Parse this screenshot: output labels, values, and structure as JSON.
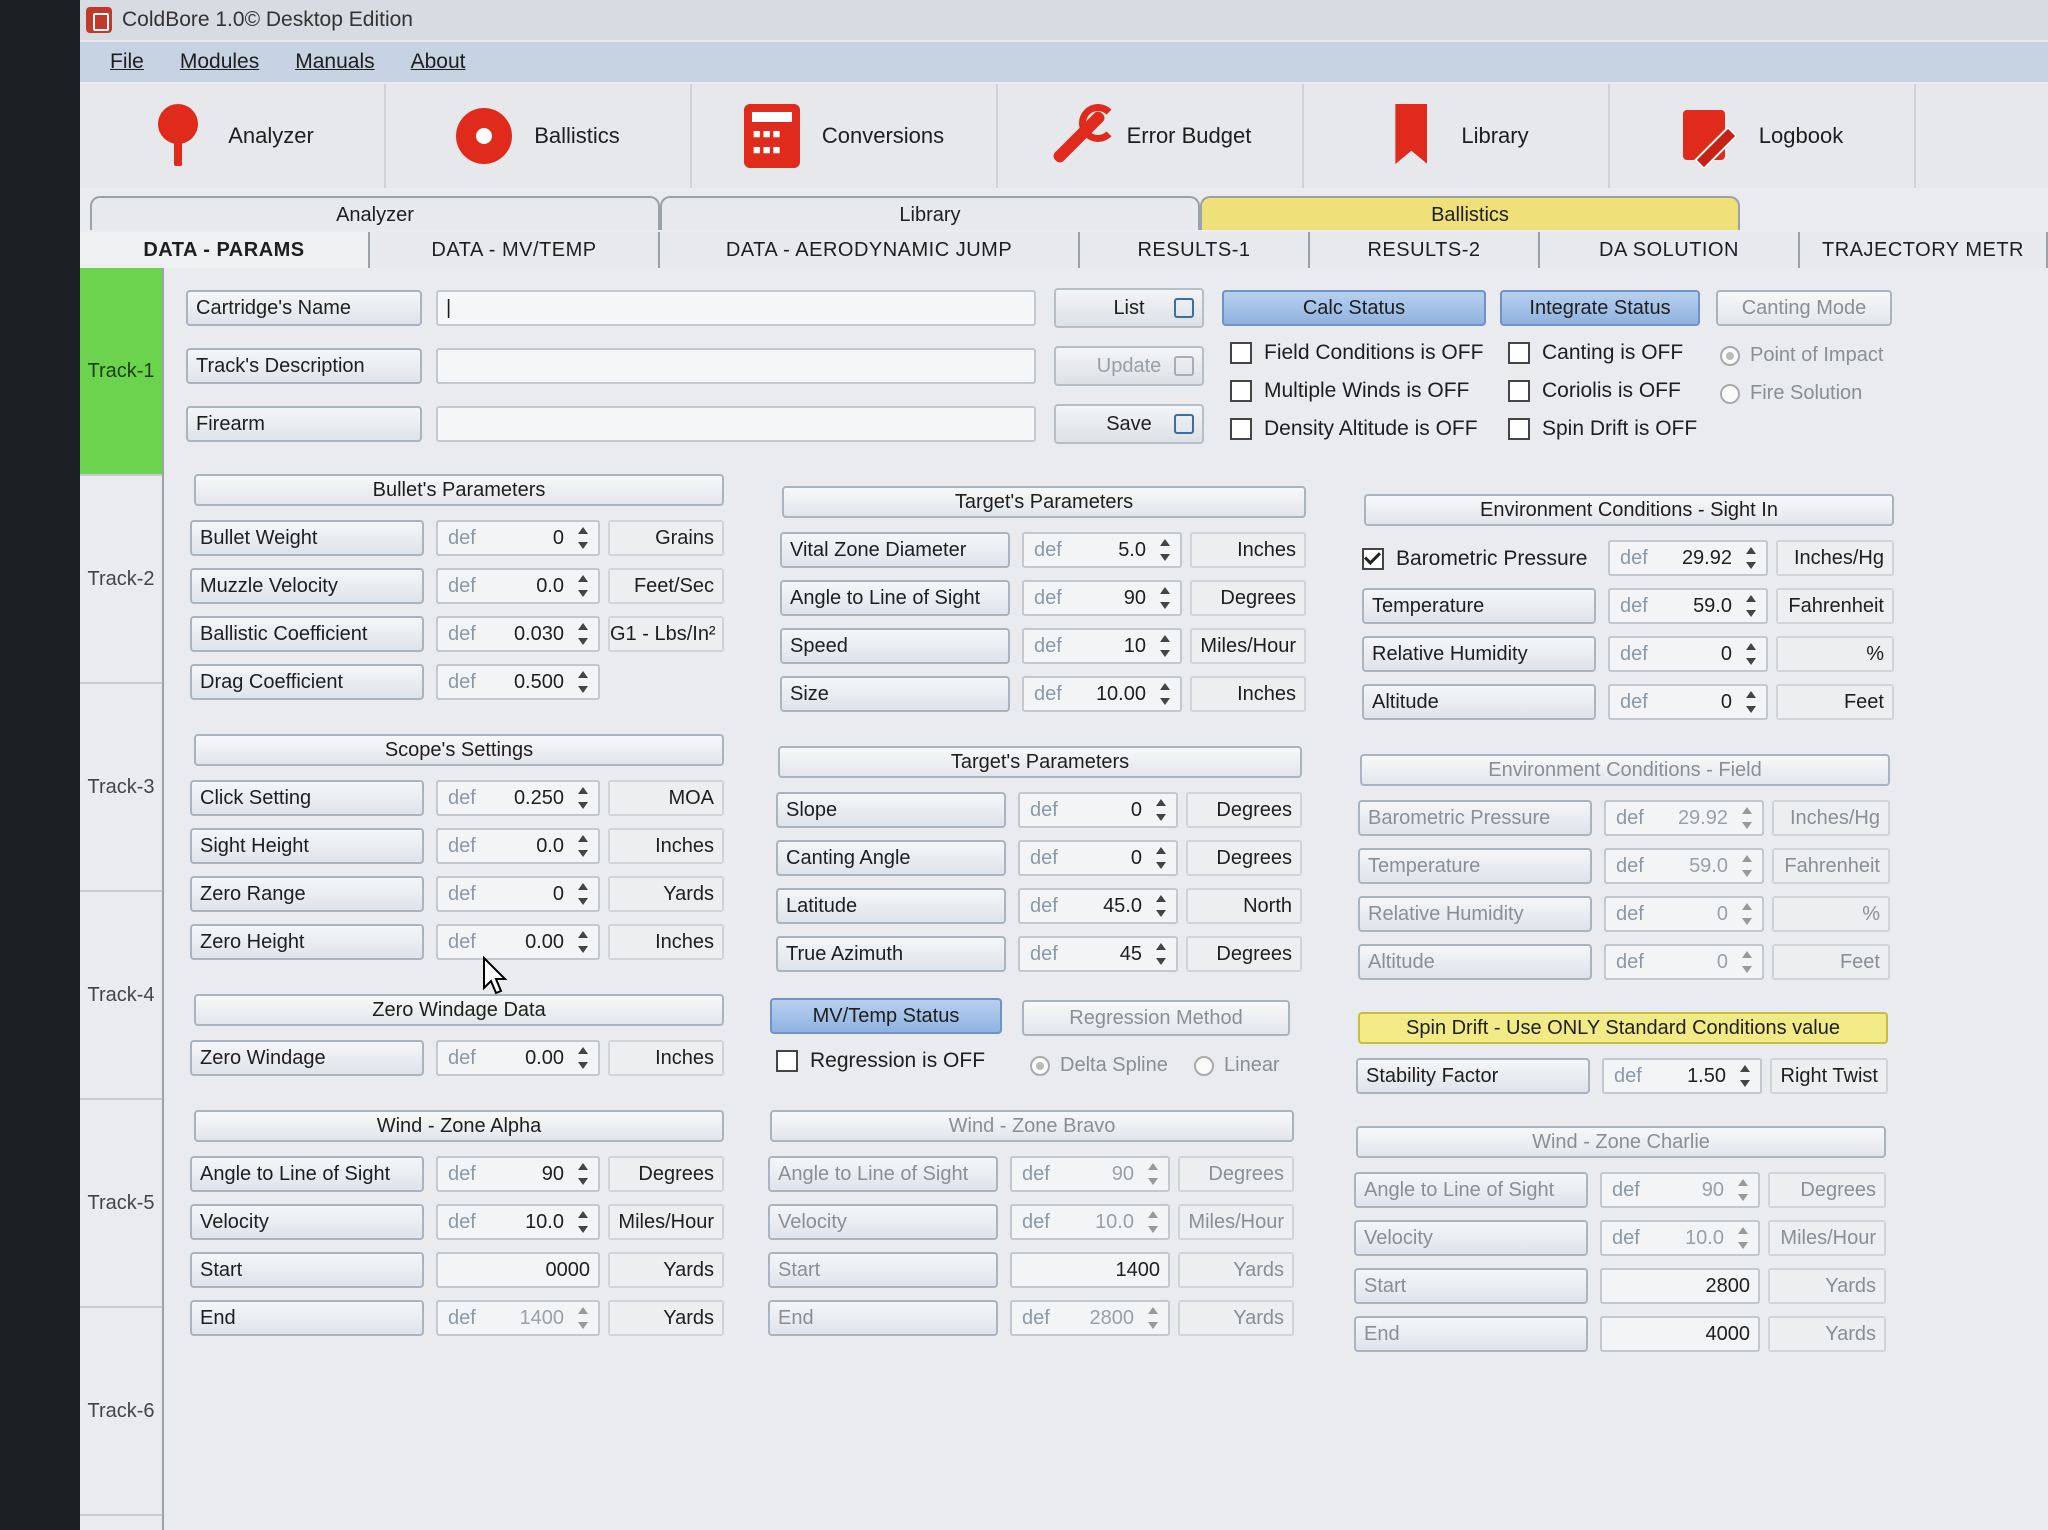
{
  "window": {
    "title": "ColdBore 1.0© Desktop Edition"
  },
  "menu": [
    "File",
    "Modules",
    "Manuals",
    "About"
  ],
  "toolbar": [
    {
      "label": "Analyzer",
      "icon": "pin-icon"
    },
    {
      "label": "Ballistics",
      "icon": "target-icon"
    },
    {
      "label": "Conversions",
      "icon": "calculator-icon"
    },
    {
      "label": "Error Budget",
      "icon": "wrench-icon"
    },
    {
      "label": "Library",
      "icon": "bookmark-icon"
    },
    {
      "label": "Logbook",
      "icon": "logbook-icon"
    }
  ],
  "groups": [
    "Analyzer",
    "Library",
    "Ballistics"
  ],
  "subtabs": [
    "DATA - PARAMS",
    "DATA - MV/TEMP",
    "DATA - AERODYNAMIC JUMP",
    "RESULTS-1",
    "RESULTS-2",
    "DA SOLUTION",
    "TRAJECTORY METR"
  ],
  "tracks": [
    "Track-1",
    "Track-2",
    "Track-3",
    "Track-4",
    "Track-5",
    "Track-6"
  ],
  "header_fields": {
    "cartridge": {
      "label": "Cartridge's Name",
      "value": "|"
    },
    "description": {
      "label": "Track's Description",
      "value": ""
    },
    "firearm": {
      "label": "Firearm",
      "value": ""
    }
  },
  "buttons": {
    "list": "List",
    "update": "Update",
    "save": "Save"
  },
  "calc_status": {
    "title": "Calc Status",
    "items": [
      "Field Conditions is OFF",
      "Multiple Winds is OFF",
      "Density Altitude is OFF"
    ]
  },
  "integrate_status": {
    "title": "Integrate Status",
    "items": [
      "Canting is OFF",
      "Coriolis is OFF",
      "Spin Drift is OFF"
    ]
  },
  "canting_mode": {
    "title": "Canting Mode",
    "options": [
      "Point of Impact",
      "Fire Solution"
    ]
  },
  "def": "def",
  "bullet": {
    "title": "Bullet's Parameters",
    "rows": [
      {
        "label": "Bullet Weight",
        "value": "0",
        "unit": "Grains"
      },
      {
        "label": "Muzzle Velocity",
        "value": "0.0",
        "unit": "Feet/Sec"
      },
      {
        "label": "Ballistic Coefficient",
        "value": "0.030",
        "unit": "G1 - Lbs/In²"
      },
      {
        "label": "Drag Coefficient",
        "value": "0.500",
        "unit": ""
      }
    ]
  },
  "scope": {
    "title": "Scope's Settings",
    "rows": [
      {
        "label": "Click Setting",
        "value": "0.250",
        "unit": "MOA"
      },
      {
        "label": "Sight Height",
        "value": "0.0",
        "unit": "Inches"
      },
      {
        "label": "Zero Range",
        "value": "0",
        "unit": "Yards"
      },
      {
        "label": "Zero Height",
        "value": "0.00",
        "unit": "Inches"
      }
    ]
  },
  "zero_windage": {
    "title": "Zero Windage Data",
    "row": {
      "label": "Zero Windage",
      "value": "0.00",
      "unit": "Inches"
    }
  },
  "target1": {
    "title": "Target's Parameters",
    "rows": [
      {
        "label": "Vital Zone Diameter",
        "value": "5.0",
        "unit": "Inches"
      },
      {
        "label": "Angle to Line of Sight",
        "value": "90",
        "unit": "Degrees"
      },
      {
        "label": "Speed",
        "value": "10",
        "unit": "Miles/Hour"
      },
      {
        "label": "Size",
        "value": "10.00",
        "unit": "Inches"
      }
    ]
  },
  "target2": {
    "title": "Target's Parameters",
    "rows": [
      {
        "label": "Slope",
        "value": "0",
        "unit": "Degrees"
      },
      {
        "label": "Canting Angle",
        "value": "0",
        "unit": "Degrees"
      },
      {
        "label": "Latitude",
        "value": "45.0",
        "unit": "North"
      },
      {
        "label": "True Azimuth",
        "value": "45",
        "unit": "Degrees"
      }
    ]
  },
  "mv_temp": {
    "title": "MV/Temp Status",
    "check": "Regression is OFF"
  },
  "regression": {
    "title": "Regression Method",
    "options": [
      "Delta Spline",
      "Linear"
    ]
  },
  "env_sight": {
    "title": "Environment Conditions - Sight In",
    "rows": [
      {
        "label": "Barometric Pressure",
        "value": "29.92",
        "unit": "Inches/Hg"
      },
      {
        "label": "Temperature",
        "value": "59.0",
        "unit": "Fahrenheit"
      },
      {
        "label": "Relative Humidity",
        "value": "0",
        "unit": "%"
      },
      {
        "label": "Altitude",
        "value": "0",
        "unit": "Feet"
      }
    ]
  },
  "env_field": {
    "title": "Environment Conditions - Field",
    "rows": [
      {
        "label": "Barometric Pressure",
        "value": "29.92",
        "unit": "Inches/Hg"
      },
      {
        "label": "Temperature",
        "value": "59.0",
        "unit": "Fahrenheit"
      },
      {
        "label": "Relative Humidity",
        "value": "0",
        "unit": "%"
      },
      {
        "label": "Altitude",
        "value": "0",
        "unit": "Feet"
      }
    ]
  },
  "spin_drift": {
    "title": "Spin Drift - Use ONLY Standard Conditions value",
    "row": {
      "label": "Stability Factor",
      "value": "1.50",
      "unit": "Right Twist"
    }
  },
  "wind_alpha": {
    "title": "Wind - Zone Alpha",
    "angle": {
      "label": "Angle to Line of Sight",
      "value": "90",
      "unit": "Degrees"
    },
    "velocity": {
      "label": "Velocity",
      "value": "10.0",
      "unit": "Miles/Hour"
    },
    "start": {
      "label": "Start",
      "value": "0000",
      "unit": "Yards"
    },
    "end": {
      "label": "End",
      "value": "1400",
      "unit": "Yards"
    }
  },
  "wind_bravo": {
    "title": "Wind - Zone Bravo",
    "angle": {
      "label": "Angle to Line of Sight",
      "value": "90",
      "unit": "Degrees"
    },
    "velocity": {
      "label": "Velocity",
      "value": "10.0",
      "unit": "Miles/Hour"
    },
    "start": {
      "label": "Start",
      "value": "1400",
      "unit": "Yards"
    },
    "end": {
      "label": "End",
      "value": "2800",
      "unit": "Yards"
    }
  },
  "wind_charlie": {
    "title": "Wind - Zone Charlie",
    "angle": {
      "label": "Angle to Line of Sight",
      "value": "90",
      "unit": "Degrees"
    },
    "velocity": {
      "label": "Velocity",
      "value": "10.0",
      "unit": "Miles/Hour"
    },
    "start": {
      "label": "Start",
      "value": "2800",
      "unit": "Yards"
    },
    "end": {
      "label": "End",
      "value": "4000",
      "unit": "Yards"
    }
  }
}
